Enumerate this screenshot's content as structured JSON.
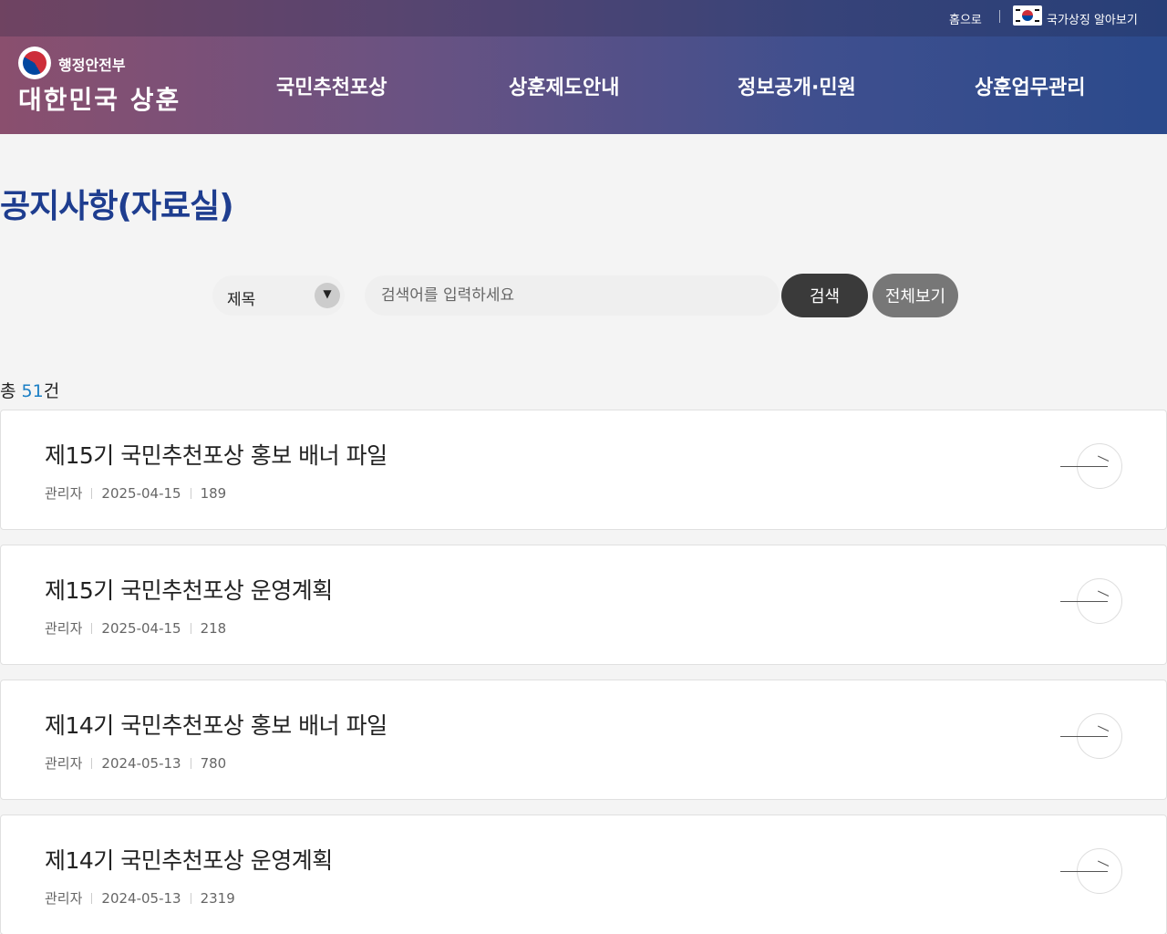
{
  "util": {
    "home": "홈으로",
    "symbol": "국가상징 알아보기"
  },
  "logo": {
    "ministry": "행정안전부",
    "title": "대한민국 상훈"
  },
  "nav": [
    "국민추천포상",
    "상훈제도안내",
    "정보공개·민원",
    "상훈업무관리"
  ],
  "page_title": "공지사항(자료실)",
  "search": {
    "field_selected": "제목",
    "placeholder": "검색어를 입력하세요",
    "search_button": "검색",
    "all_button": "전체보기"
  },
  "total": {
    "prefix": "총 ",
    "count": "51",
    "suffix": "건"
  },
  "posts": [
    {
      "title": "제15기 국민추천포상 홍보 배너 파일",
      "author": "관리자",
      "date": "2025-04-15",
      "views": "189"
    },
    {
      "title": "제15기 국민추천포상 운영계획",
      "author": "관리자",
      "date": "2025-04-15",
      "views": "218"
    },
    {
      "title": "제14기 국민추천포상 홍보 배너 파일",
      "author": "관리자",
      "date": "2024-05-13",
      "views": "780"
    },
    {
      "title": "제14기 국민추천포상 운영계획",
      "author": "관리자",
      "date": "2024-05-13",
      "views": "2319"
    }
  ],
  "colors": {
    "accent": "#1e3d8f",
    "count": "#1b7fc5",
    "search_button": "#3a3a3a",
    "all_button": "#777777"
  }
}
